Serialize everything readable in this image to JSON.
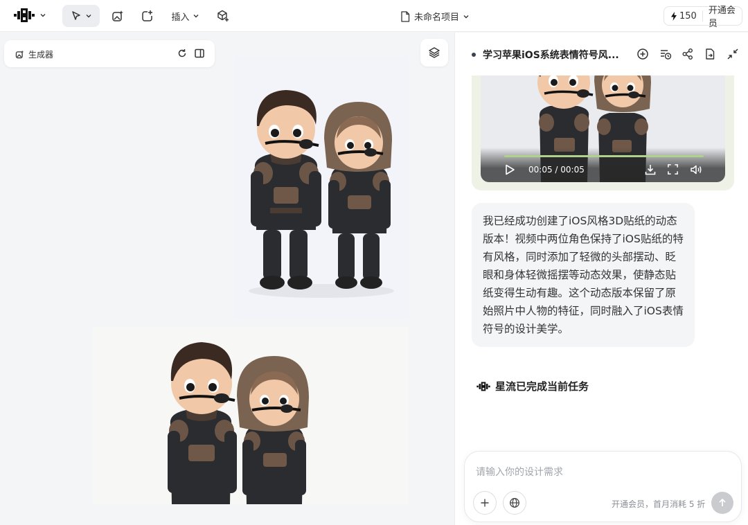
{
  "toolbar": {
    "logo": "xingliu-logo",
    "insert_label": "插入",
    "project_name": "未命名项目",
    "credits": "150",
    "upgrade_label": "开通会员"
  },
  "canvas": {
    "generator_label": "生成器",
    "images": [
      {
        "description": "3d-sticker-two-characters-portrait"
      },
      {
        "description": "3d-sticker-two-characters-landscape"
      }
    ]
  },
  "chat": {
    "title": "学习苹果iOS系统表情符号风...",
    "video": {
      "time": "00:05 / 00:05",
      "progress": 1.0
    },
    "message": "我已经成功创建了iOS风格3D贴纸的动态版本！视频中两位角色保持了iOS贴纸的特有风格，同时添加了轻微的头部摆动、眨眼和身体轻微摇摆等动态效果，使静态贴纸变得生动有趣。这个动态版本保留了原始照片中人物的特征，同时融入了iOS表情符号的设计美学。",
    "task_done": "星流已完成当前任务",
    "input_placeholder": "请输入你的设计需求",
    "hint": "开通会员，首月消耗 5 折"
  },
  "colors": {
    "accent_bg": "#ecedf0",
    "video_card_bg": "#eef1e6",
    "progress": "#aed28a",
    "send_button": "#c9cbcf"
  }
}
